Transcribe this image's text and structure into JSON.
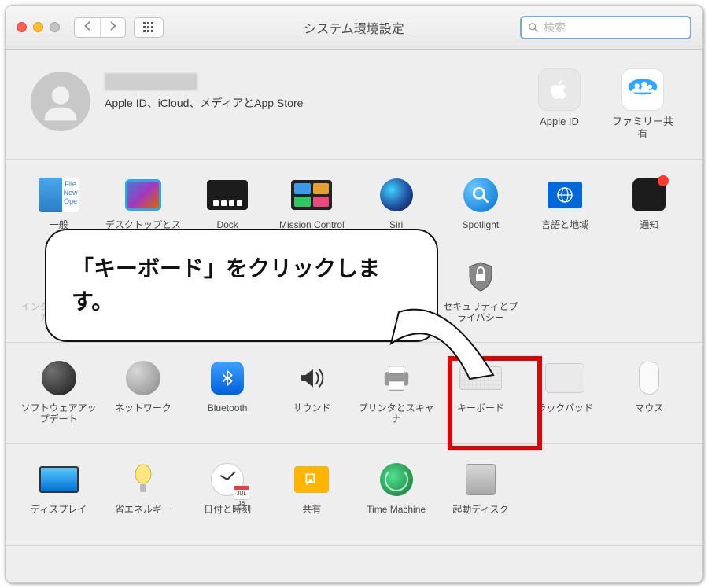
{
  "toolbar": {
    "title": "システム環境設定",
    "search_placeholder": "検索"
  },
  "account": {
    "subtitle": "Apple ID、iCloud、メディアとApp Store",
    "appleid_label": "Apple ID",
    "family_label": "ファミリー共有"
  },
  "callout": {
    "text": "「キーボード」をクリックします。"
  },
  "section1": [
    {
      "label": "一般"
    },
    {
      "label": "デスクトップとスクリーンセーバ"
    },
    {
      "label": "Dock"
    },
    {
      "label": "Mission Control"
    },
    {
      "label": "Siri"
    },
    {
      "label": "Spotlight"
    },
    {
      "label": "言語と地域"
    },
    {
      "label": "通知"
    },
    {
      "label": "インターネットアカウント"
    },
    {
      "label": ""
    },
    {
      "label": ""
    },
    {
      "label": ""
    },
    {
      "label": ""
    },
    {
      "label": "セキュリティとプライバシー"
    }
  ],
  "section2": [
    {
      "label": "ソフトウェアアップデート"
    },
    {
      "label": "ネットワーク"
    },
    {
      "label": "Bluetooth"
    },
    {
      "label": "サウンド"
    },
    {
      "label": "プリンタとスキャナ"
    },
    {
      "label": "キーボード"
    },
    {
      "label": "ラックパッド"
    },
    {
      "label": "マウス"
    }
  ],
  "section3": [
    {
      "label": "ディスプレイ"
    },
    {
      "label": "省エネルギー"
    },
    {
      "label": "日付と時刻"
    },
    {
      "label": "共有"
    },
    {
      "label": "Time Machine"
    },
    {
      "label": "起動ディスク"
    }
  ],
  "datetime_cal": "JUL 18"
}
